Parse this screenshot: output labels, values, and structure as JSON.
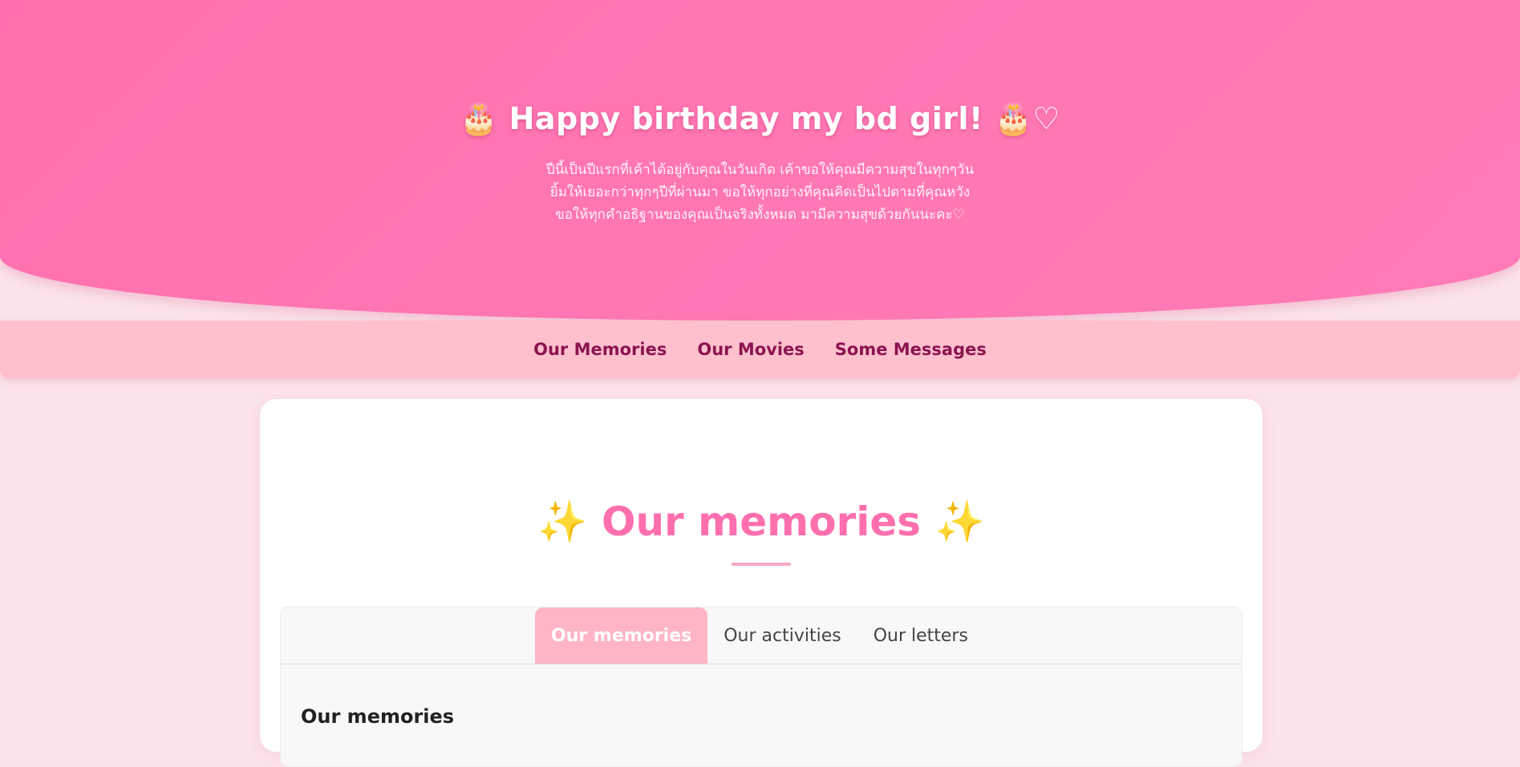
{
  "hero": {
    "title": "🎂 Happy birthday my bd girl! 🎂♡",
    "message_lines": [
      "ปีนี้เป็นปีแรกที่เค้าได้อยู่กับคุณในวันเกิด เค้าขอให้คุณมีความสุขในทุกๆวัน",
      "ยิ้มให้เยอะกว่าทุกๆปีที่ผ่านมา ขอให้ทุกอย่างที่คุณคิดเป็นไปตามที่คุณหวัง",
      "ขอให้ทุกคำอธิฐานของคุณเป็นจริงทั้งหมด มามีความสุขด้วยกันนะคะ♡"
    ]
  },
  "nav": {
    "items": [
      {
        "label": "Our Memories"
      },
      {
        "label": "Our Movies"
      },
      {
        "label": "Some Messages"
      }
    ]
  },
  "section": {
    "title": "Our memories",
    "sparkle_left": "✨",
    "sparkle_right": "✨"
  },
  "tabs": {
    "items": [
      {
        "label": "Our memories",
        "active": true
      },
      {
        "label": "Our activities",
        "active": false
      },
      {
        "label": "Our letters",
        "active": false
      }
    ],
    "content_heading": "Our memories"
  },
  "colors": {
    "hero_pink": "#ff6fae",
    "nav_pink": "#ffc0cd",
    "nav_text": "#8a1450",
    "active_tab": "#ffb5c5",
    "sparkle": "#f5c43a",
    "page_bg": "#fbe4ea"
  }
}
